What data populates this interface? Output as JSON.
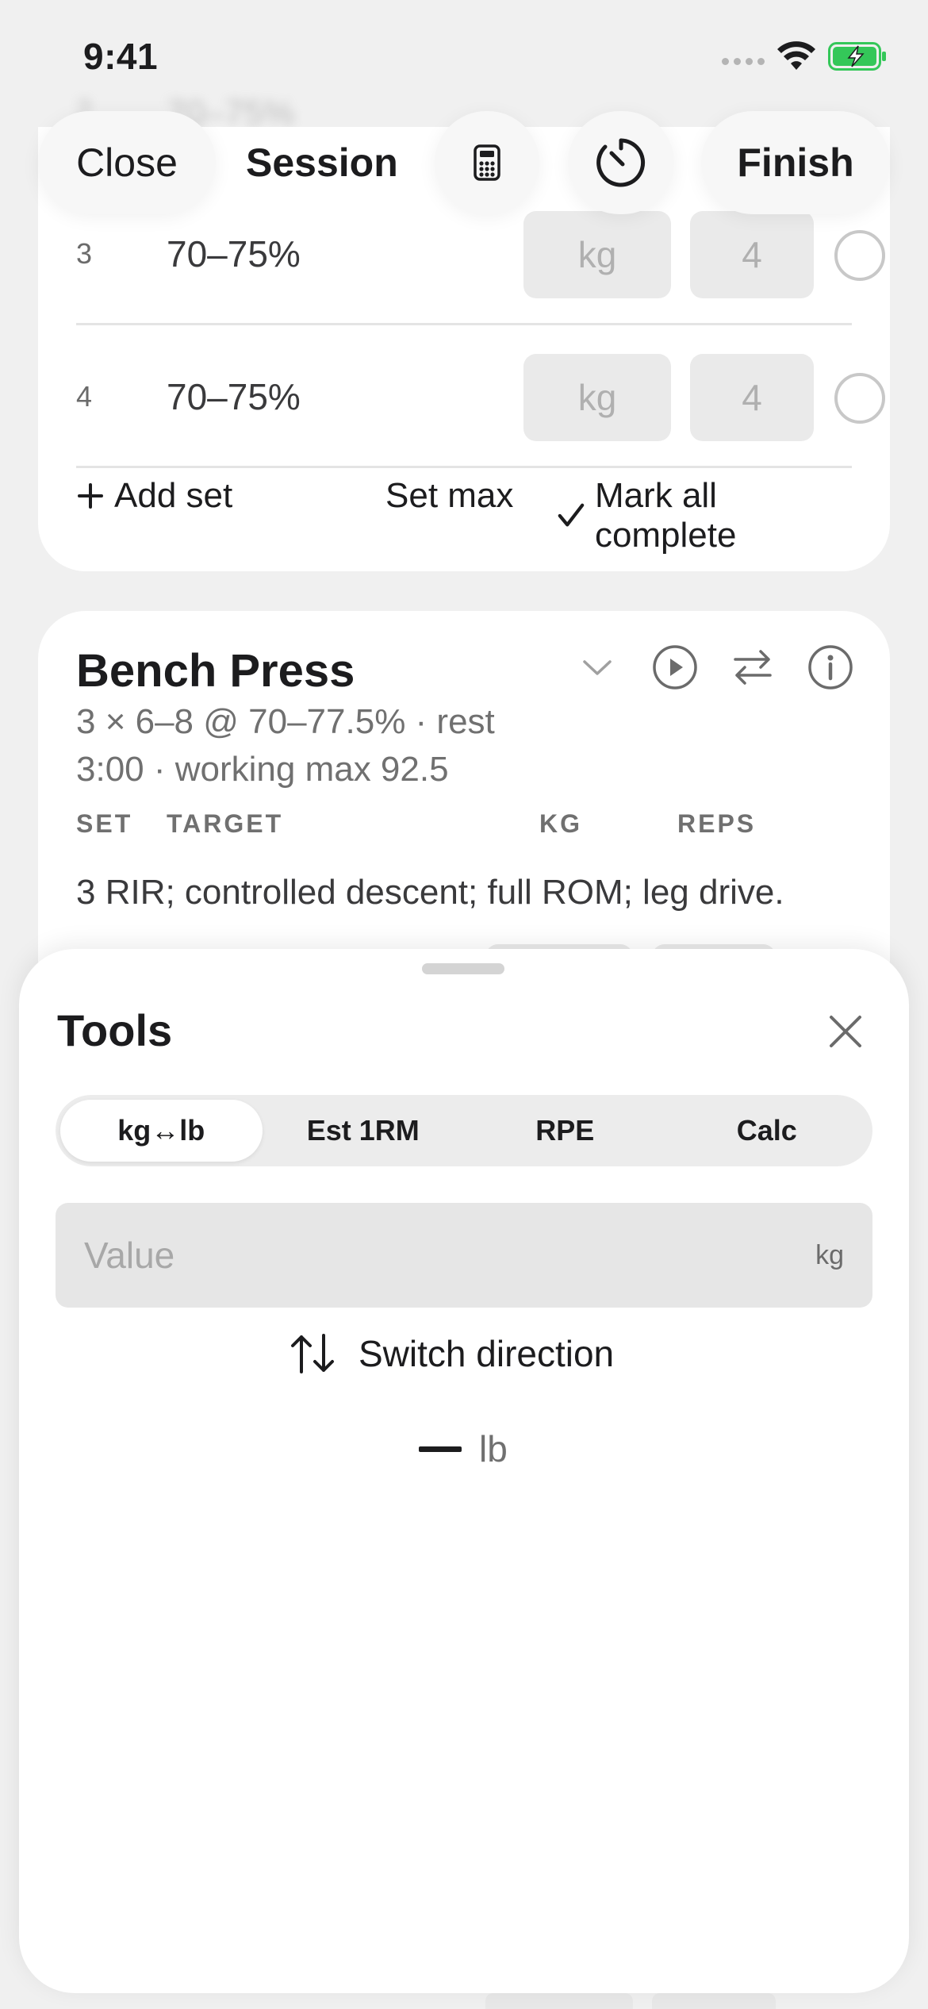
{
  "status_bar": {
    "time": "9:41"
  },
  "top_bar": {
    "close_label": "Close",
    "title": "Session",
    "finish_label": "Finish"
  },
  "previous_exercise": {
    "ghost_row": {
      "set": "2",
      "target": "70–75%"
    },
    "sets": [
      {
        "set": "3",
        "target": "70–75%",
        "kg_placeholder": "kg",
        "reps_placeholder": "4"
      },
      {
        "set": "4",
        "target": "70–75%",
        "kg_placeholder": "kg",
        "reps_placeholder": "4"
      }
    ],
    "actions": {
      "add_set": "Add set",
      "set_max": "Set max",
      "mark_all": "Mark all complete"
    }
  },
  "exercise": {
    "title": "Bench Press",
    "subtitle_line1": "3 × 6–8 @ 70–77.5% · rest",
    "subtitle_line2": "3:00 · working max 92.5",
    "columns": {
      "set": "SET",
      "target": "TARGET",
      "kg": "KG",
      "reps": "REPS"
    },
    "note": "3 RIR; controlled descent; full ROM; leg drive."
  },
  "tools_sheet": {
    "title": "Tools",
    "tabs": [
      {
        "label": "kg↔lb",
        "active": true
      },
      {
        "label": "Est 1RM",
        "active": false
      },
      {
        "label": "RPE",
        "active": false
      },
      {
        "label": "Calc",
        "active": false
      }
    ],
    "value_placeholder": "Value",
    "value_unit": "kg",
    "switch_label": "Switch direction",
    "result_unit": "lb"
  },
  "colors": {
    "battery": "#34c759",
    "text_primary": "#1c1c1e",
    "text_secondary": "#707070"
  }
}
